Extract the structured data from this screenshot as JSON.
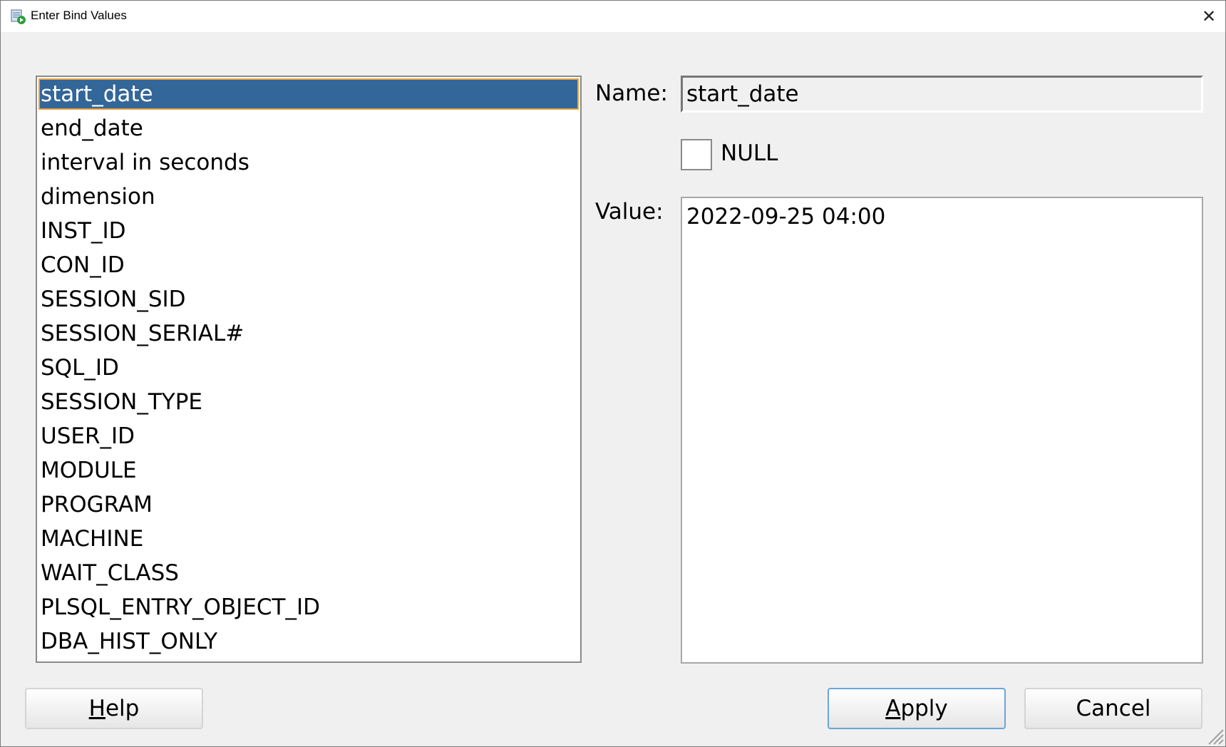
{
  "window": {
    "title": "Enter Bind Values",
    "close_symbol": "✕",
    "icon": "sql-worksheet-run-icon"
  },
  "bind_list": {
    "items": [
      "start_date",
      "end_date",
      "interval in seconds",
      "dimension",
      "INST_ID",
      "CON_ID",
      "SESSION_SID",
      "SESSION_SERIAL#",
      "SQL_ID",
      "SESSION_TYPE",
      "USER_ID",
      "MODULE",
      "PROGRAM",
      "MACHINE",
      "WAIT_CLASS",
      "PLSQL_ENTRY_OBJECT_ID",
      "DBA_HIST_ONLY"
    ],
    "selected_index": 0
  },
  "form": {
    "name_label": "Name:",
    "name_value": "start_date",
    "null_label": "NULL",
    "null_checked": false,
    "value_label": "Value:",
    "value_text": "2022-09-25 04:00"
  },
  "buttons": {
    "help": {
      "mnemonic": "H",
      "rest": "elp"
    },
    "apply": {
      "mnemonic": "A",
      "rest": "pply"
    },
    "cancel": "Cancel"
  },
  "colors": {
    "selection_bg": "#336699",
    "selection_border": "#e8a33d",
    "focus_border": "#6aa6d8"
  }
}
